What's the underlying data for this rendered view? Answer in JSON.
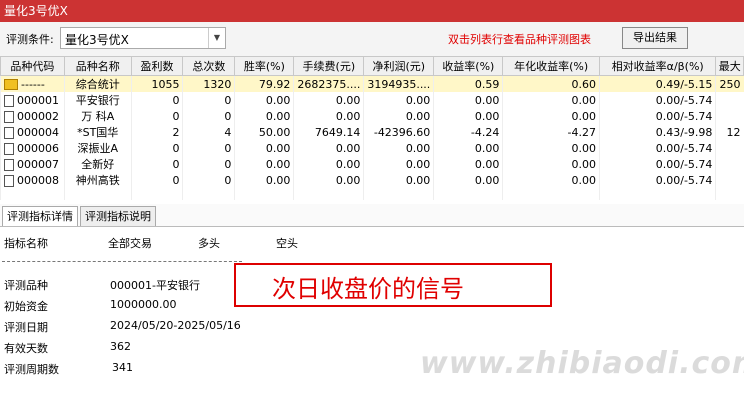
{
  "window": {
    "title": "量化3号优X"
  },
  "toolbar": {
    "label": "评测条件:",
    "selected": "量化3号优X",
    "hint": "双击列表行查看品种评测图表",
    "export_label": "导出结果"
  },
  "table": {
    "headers": [
      "品种代码",
      "品种名称",
      "盈利数",
      "总次数",
      "胜率(%)",
      "手续费(元)",
      "净利润(元)",
      "收益率(%)",
      "年化收益率(%)",
      "相对收益率α/β(%)",
      "最大"
    ],
    "rows": [
      [
        "------",
        "综合统计",
        "1055",
        "1320",
        "79.92",
        "2682375....",
        "3194935....",
        "0.59",
        "0.60",
        "0.49/-5.15",
        "250"
      ],
      [
        "000001",
        "平安银行",
        "0",
        "0",
        "0.00",
        "0.00",
        "0.00",
        "0.00",
        "0.00",
        "0.00/-5.74",
        ""
      ],
      [
        "000002",
        "万 科A",
        "0",
        "0",
        "0.00",
        "0.00",
        "0.00",
        "0.00",
        "0.00",
        "0.00/-5.74",
        ""
      ],
      [
        "000004",
        "*ST国华",
        "2",
        "4",
        "50.00",
        "7649.14",
        "-42396.60",
        "-4.24",
        "-4.27",
        "0.43/-9.98",
        "12"
      ],
      [
        "000006",
        "深振业A",
        "0",
        "0",
        "0.00",
        "0.00",
        "0.00",
        "0.00",
        "0.00",
        "0.00/-5.74",
        ""
      ],
      [
        "000007",
        "全新好",
        "0",
        "0",
        "0.00",
        "0.00",
        "0.00",
        "0.00",
        "0.00",
        "0.00/-5.74",
        ""
      ],
      [
        "000008",
        "神州高铁",
        "0",
        "0",
        "0.00",
        "0.00",
        "0.00",
        "0.00",
        "0.00",
        "0.00/-5.74",
        ""
      ],
      [
        "",
        "",
        "",
        "",
        "",
        "",
        "",
        "",
        "",
        "",
        ""
      ]
    ]
  },
  "tabs": [
    "评测指标详情",
    "评测指标说明"
  ],
  "detail": {
    "head_name": "指标名称",
    "head_all": "全部交易",
    "head_long": "多头",
    "head_short": "空头",
    "rows": [
      {
        "label": "评测品种",
        "value": "000001-平安银行"
      },
      {
        "label": "初始资金",
        "value": "1000000.00"
      },
      {
        "label": "评测日期",
        "value": "2024/05/20-2025/05/16"
      },
      {
        "label": "有效天数",
        "value": "362"
      },
      {
        "label": "评测周期数",
        "value": "341"
      }
    ]
  },
  "annotation": "次日收盘价的信号",
  "watermark": "www.zhibiaodi.com"
}
